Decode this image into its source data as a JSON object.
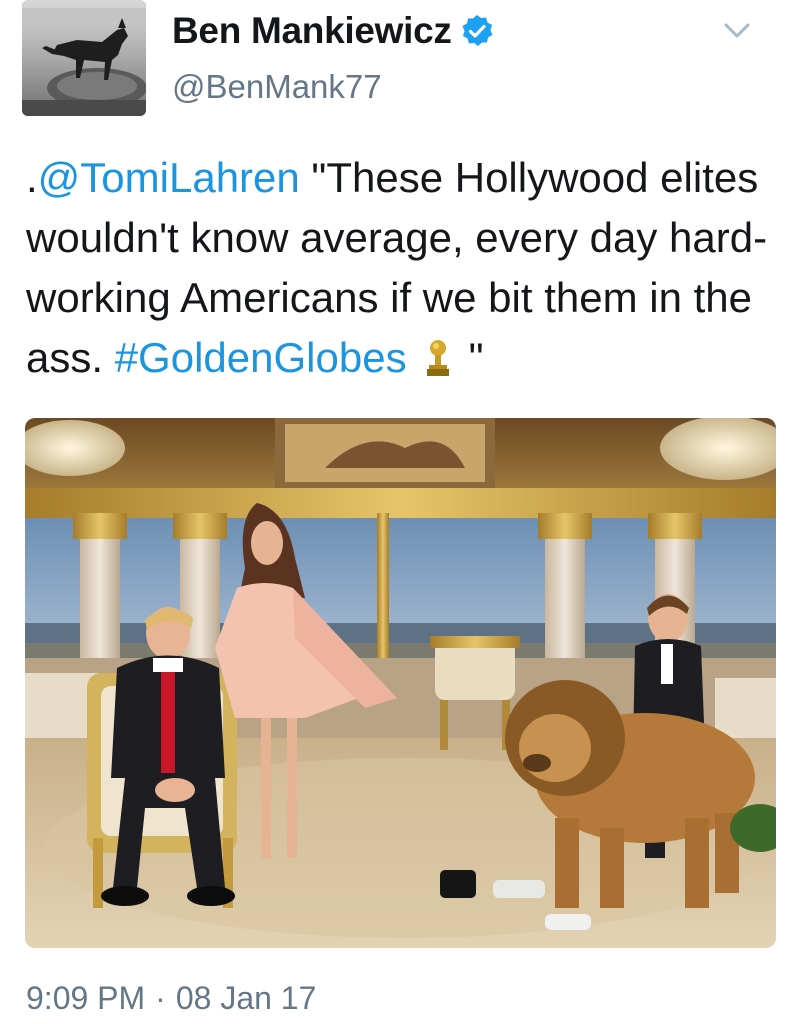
{
  "tweet": {
    "author": {
      "display_name": "Ben Mankiewicz",
      "handle": "@BenMank77",
      "verified": true
    },
    "text": {
      "prefix": ".",
      "mention": "@TomiLahren",
      "body": " \"These Hollywood elites wouldn't know average, every day hard-working Americans if we bit them in the ass. ",
      "hashtag": "#GoldenGlobes",
      "emoji": "golden-globe-trophy-icon",
      "suffix": "\""
    },
    "time": "9:09 PM",
    "separator": "·",
    "date": "08 Jan 17"
  },
  "colors": {
    "link": "#1b95e0",
    "verified_badge": "#1da1f2",
    "secondary_text": "#657786",
    "primary_text": "#14171a"
  }
}
